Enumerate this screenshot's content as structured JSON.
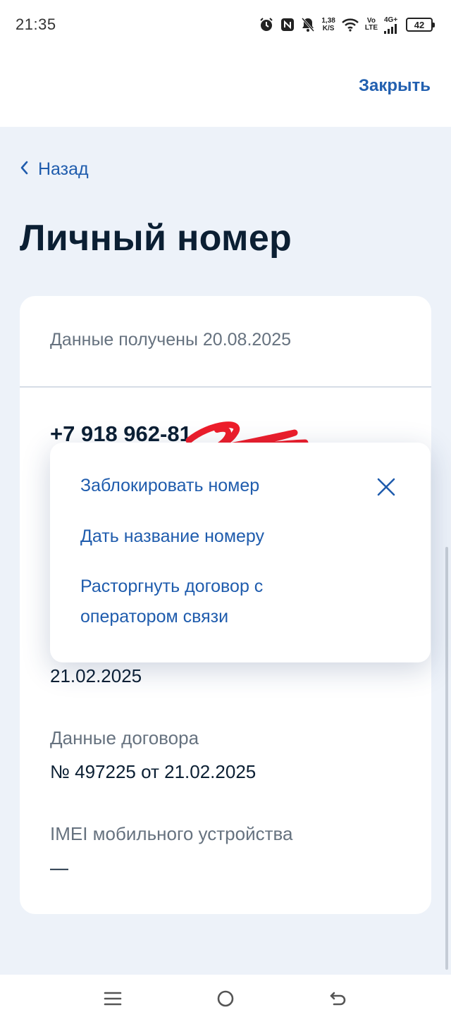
{
  "status_bar": {
    "time": "21:35",
    "net_speed_value": "1,38",
    "net_speed_unit": "K/S",
    "volte_top": "Vo",
    "volte_bottom": "LTE",
    "network": "4G+",
    "battery": "42",
    "icons": [
      "alarm-icon",
      "nfc-icon",
      "mute-bell-icon",
      "wifi-icon",
      "signal-icon",
      "battery-icon"
    ]
  },
  "header": {
    "close_label": "Закрыть"
  },
  "nav": {
    "back_label": "Назад"
  },
  "page": {
    "title": "Личный номер"
  },
  "card": {
    "received": "Данные получены 20.08.2025",
    "phone_number": "+7 918 962-81",
    "date_value": "21.02.2025",
    "contract_label": "Данные договора",
    "contract_value": "№ 497225 от 21.02.2025",
    "imei_label": "IMEI мобильного устройства",
    "imei_value": "—"
  },
  "popup": {
    "items": [
      "Заблокировать номер",
      "Дать название номеру",
      "Расторгнуть договор с оператором связи"
    ]
  },
  "colors": {
    "accent": "#1f5cad",
    "page_bg": "#edf2f9",
    "text_primary": "#0b1f33",
    "text_secondary": "#66727f",
    "scribble": "#ee1d2a"
  },
  "system_nav": {
    "icons": [
      "menu-icon",
      "home-icon",
      "back-icon"
    ]
  }
}
